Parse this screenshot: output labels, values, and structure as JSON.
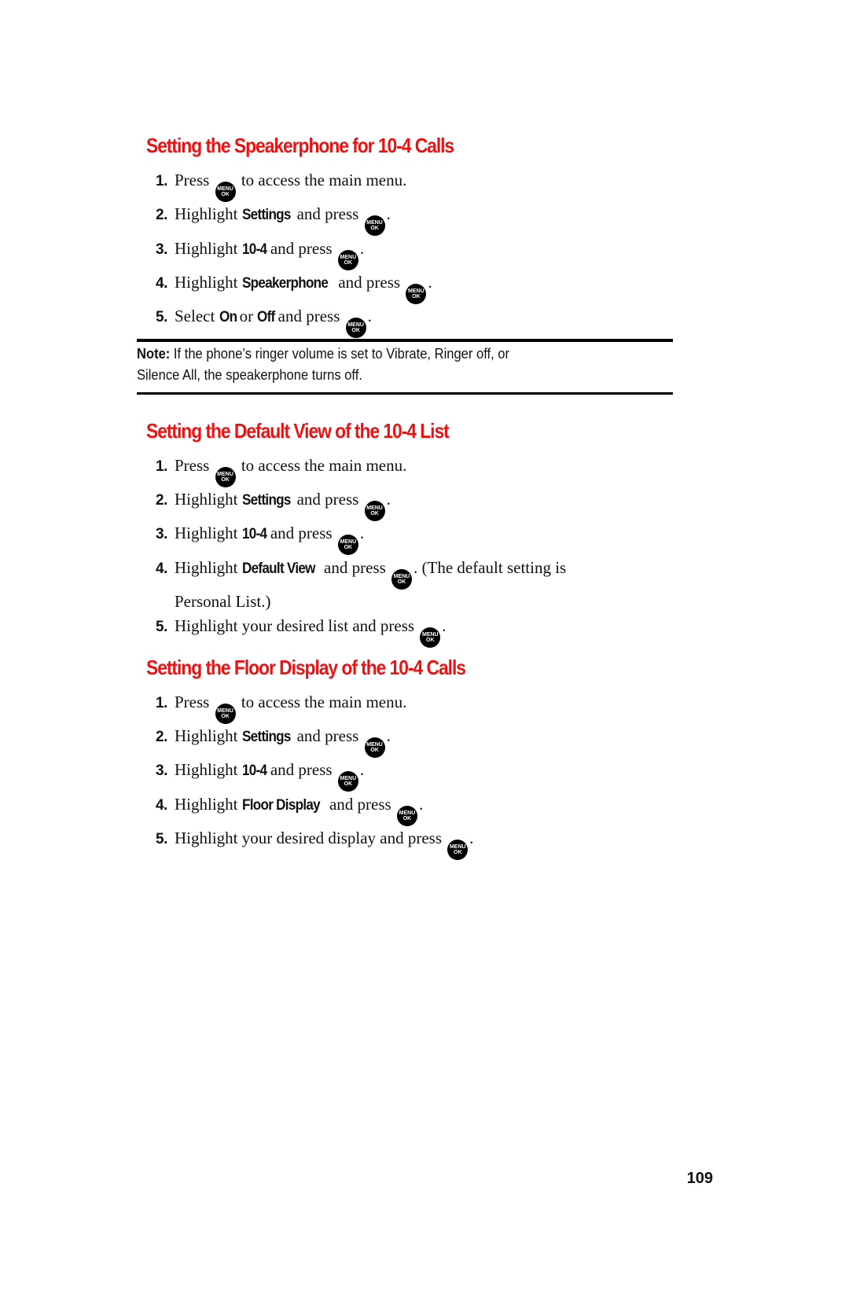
{
  "icons": {
    "menu_ok": {
      "name": "menu-ok-icon",
      "top_label": "MENU",
      "bottom_label": "OK"
    }
  },
  "sections": [
    {
      "title": "Setting the Speakerphone for 10-4 Calls",
      "steps": [
        {
          "num": "1.",
          "parts": [
            "Press ",
            "",
            " to access the main menu."
          ]
        },
        {
          "num": "2.",
          "parts": [
            "Highlight ",
            "Settings",
            " and press ",
            "",
            "."
          ]
        },
        {
          "num": "3.",
          "parts": [
            "Highlight ",
            "10-4",
            " and press ",
            "",
            "."
          ]
        },
        {
          "num": "4.",
          "parts": [
            "Highlight ",
            "Speakerphone",
            " and press ",
            "",
            "."
          ]
        },
        {
          "num": "5.",
          "parts": [
            "Select ",
            "On",
            " or ",
            "Off",
            " and press ",
            "",
            "."
          ]
        }
      ]
    },
    {
      "title": "Setting the Default View of the 10-4 List",
      "steps": [
        {
          "num": "1.",
          "parts": [
            "Press ",
            "",
            " to access the main menu."
          ]
        },
        {
          "num": "2.",
          "parts": [
            "Highlight ",
            "Settings",
            " and press ",
            "",
            "."
          ]
        },
        {
          "num": "3.",
          "parts": [
            "Highlight ",
            "10-4",
            " and press ",
            "",
            "."
          ]
        },
        {
          "num": "4.",
          "parts": [
            "Highlight ",
            "Default View",
            " and press ",
            "",
            ". (The default setting is"
          ],
          "continuation": "Personal List.)"
        },
        {
          "num": "5.",
          "parts": [
            "Highlight your desired list and press ",
            "",
            "."
          ]
        }
      ]
    },
    {
      "title": "Setting the Floor Display of the 10-4 Calls",
      "steps": [
        {
          "num": "1.",
          "parts": [
            "Press ",
            "",
            " to access the main menu."
          ]
        },
        {
          "num": "2.",
          "parts": [
            "Highlight ",
            "Settings",
            " and press ",
            "",
            "."
          ]
        },
        {
          "num": "3.",
          "parts": [
            "Highlight ",
            "10-4",
            " and press ",
            "",
            "."
          ]
        },
        {
          "num": "4.",
          "parts": [
            "Highlight ",
            "Floor Display",
            " and press ",
            "",
            "."
          ]
        },
        {
          "num": "5.",
          "parts": [
            "Highlight your desired display and press ",
            "",
            "."
          ]
        }
      ]
    }
  ],
  "note": {
    "label": "Note:",
    "line1": " If the phone’s ringer volume is set to Vibrate, Ringer off, or",
    "line2": "Silence All, the speakerphone turns off."
  },
  "page_number": "109",
  "colors": {
    "heading": "#ee1111",
    "text": "#111111",
    "icon_bg": "#000000"
  }
}
